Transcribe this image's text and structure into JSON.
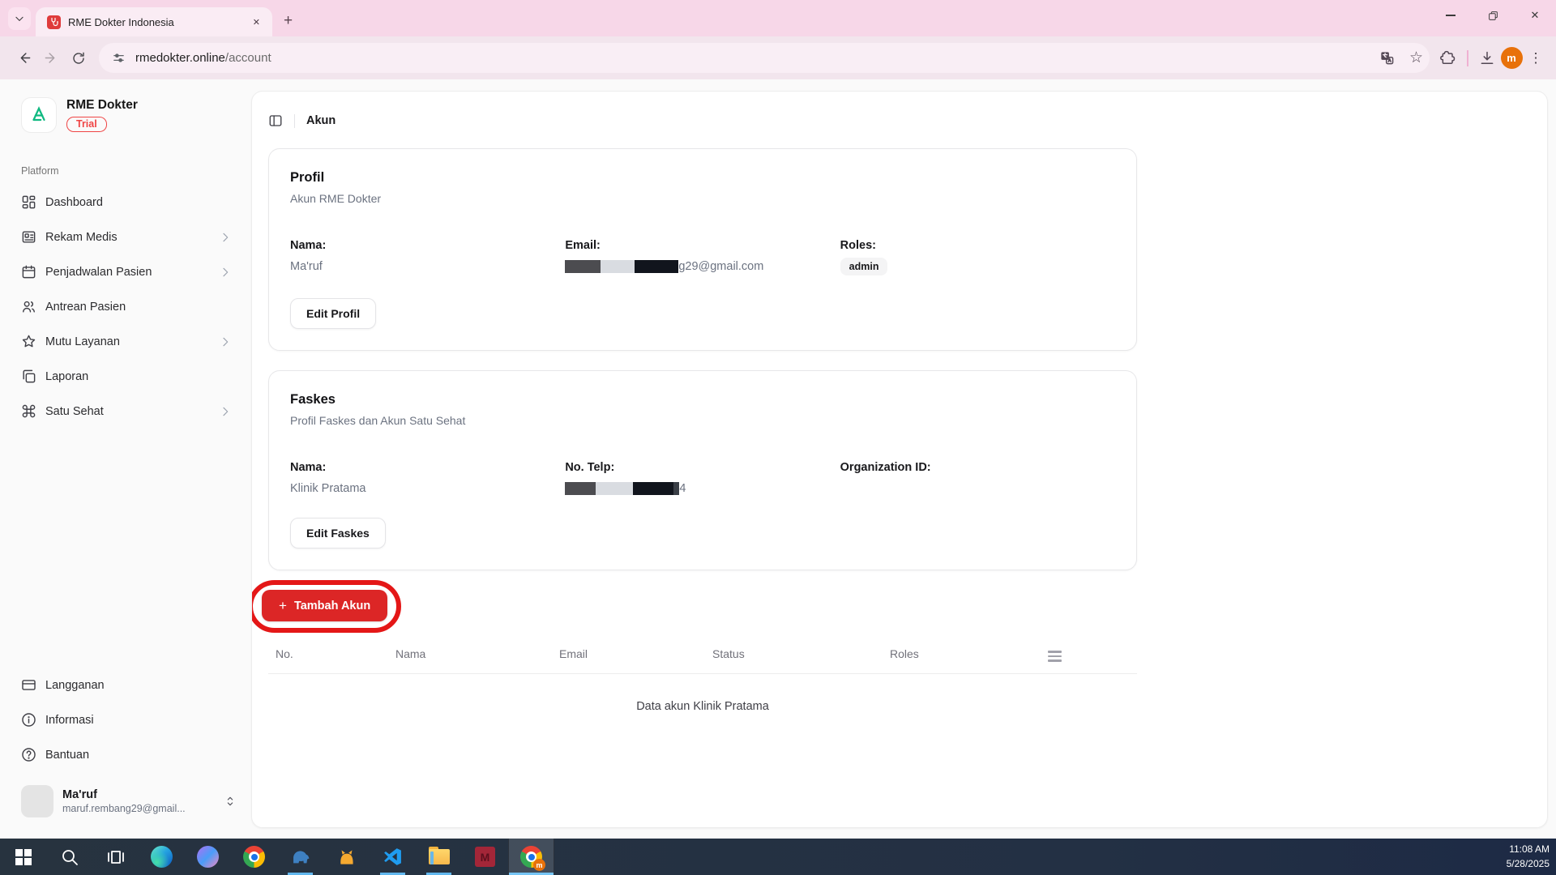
{
  "browser": {
    "tab_title": "RME Dokter Indonesia",
    "url_host": "rmedokter.online",
    "url_path": "/account",
    "profile_initial": "m"
  },
  "glyphs": {
    "plus": "+",
    "close": "✕",
    "kebab": "⋮",
    "star": "☆"
  },
  "sidebar": {
    "app_name": "RME Dokter",
    "plan_badge": "Trial",
    "section_label": "Platform",
    "items": [
      {
        "label": "Dashboard",
        "icon": "dashboard-icon",
        "has_submenu": false
      },
      {
        "label": "Rekam Medis",
        "icon": "medical-record-icon",
        "has_submenu": true
      },
      {
        "label": "Penjadwalan Pasien",
        "icon": "calendar-icon",
        "has_submenu": true
      },
      {
        "label": "Antrean Pasien",
        "icon": "users-icon",
        "has_submenu": false
      },
      {
        "label": "Mutu Layanan",
        "icon": "star-icon",
        "has_submenu": true
      },
      {
        "label": "Laporan",
        "icon": "copy-icon",
        "has_submenu": false
      },
      {
        "label": "Satu Sehat",
        "icon": "command-icon",
        "has_submenu": true
      }
    ],
    "footer_items": [
      {
        "label": "Langganan",
        "icon": "credit-card-icon"
      },
      {
        "label": "Informasi",
        "icon": "info-icon"
      },
      {
        "label": "Bantuan",
        "icon": "help-icon"
      }
    ],
    "user": {
      "name": "Ma'ruf",
      "email": "maruf.rembang29@gmail..."
    }
  },
  "main": {
    "page_title": "Akun",
    "profil_card": {
      "title": "Profil",
      "subtitle": "Akun RME Dokter",
      "nama_label": "Nama:",
      "nama_value": "Ma'ruf",
      "email_label": "Email:",
      "email_redacted": true,
      "email_visible": "g29@gmail.com",
      "roles_label": "Roles:",
      "roles_badge": "admin",
      "edit_button": "Edit Profil"
    },
    "faskes_card": {
      "title": "Faskes",
      "subtitle": "Profil Faskes dan Akun Satu Sehat",
      "nama_label": "Nama:",
      "nama_value": "Klinik Pratama",
      "telp_label": "No. Telp:",
      "telp_redacted": true,
      "telp_visible": "4",
      "org_label": "Organization ID:",
      "org_value": "",
      "edit_button": "Edit Faskes"
    },
    "add_account": {
      "label": "Tambah Akun"
    },
    "annotation": {
      "shape": "red-ellipse-highlight",
      "color": "#e41717",
      "target": "Tambah Akun"
    },
    "table": {
      "headers": [
        "No.",
        "Nama",
        "Email",
        "Status",
        "Roles"
      ],
      "empty_message": "Data akun Klinik Pratama"
    }
  },
  "taskbar": {
    "time": "11:08 AM",
    "date": "5/28/2025"
  },
  "colors": {
    "accent_red": "#dc2626",
    "annotation_red": "#e41717",
    "brand_green": "#10b981",
    "browser_theme_pink": "#f7d7e8",
    "taskbar_dark": "#233044"
  }
}
